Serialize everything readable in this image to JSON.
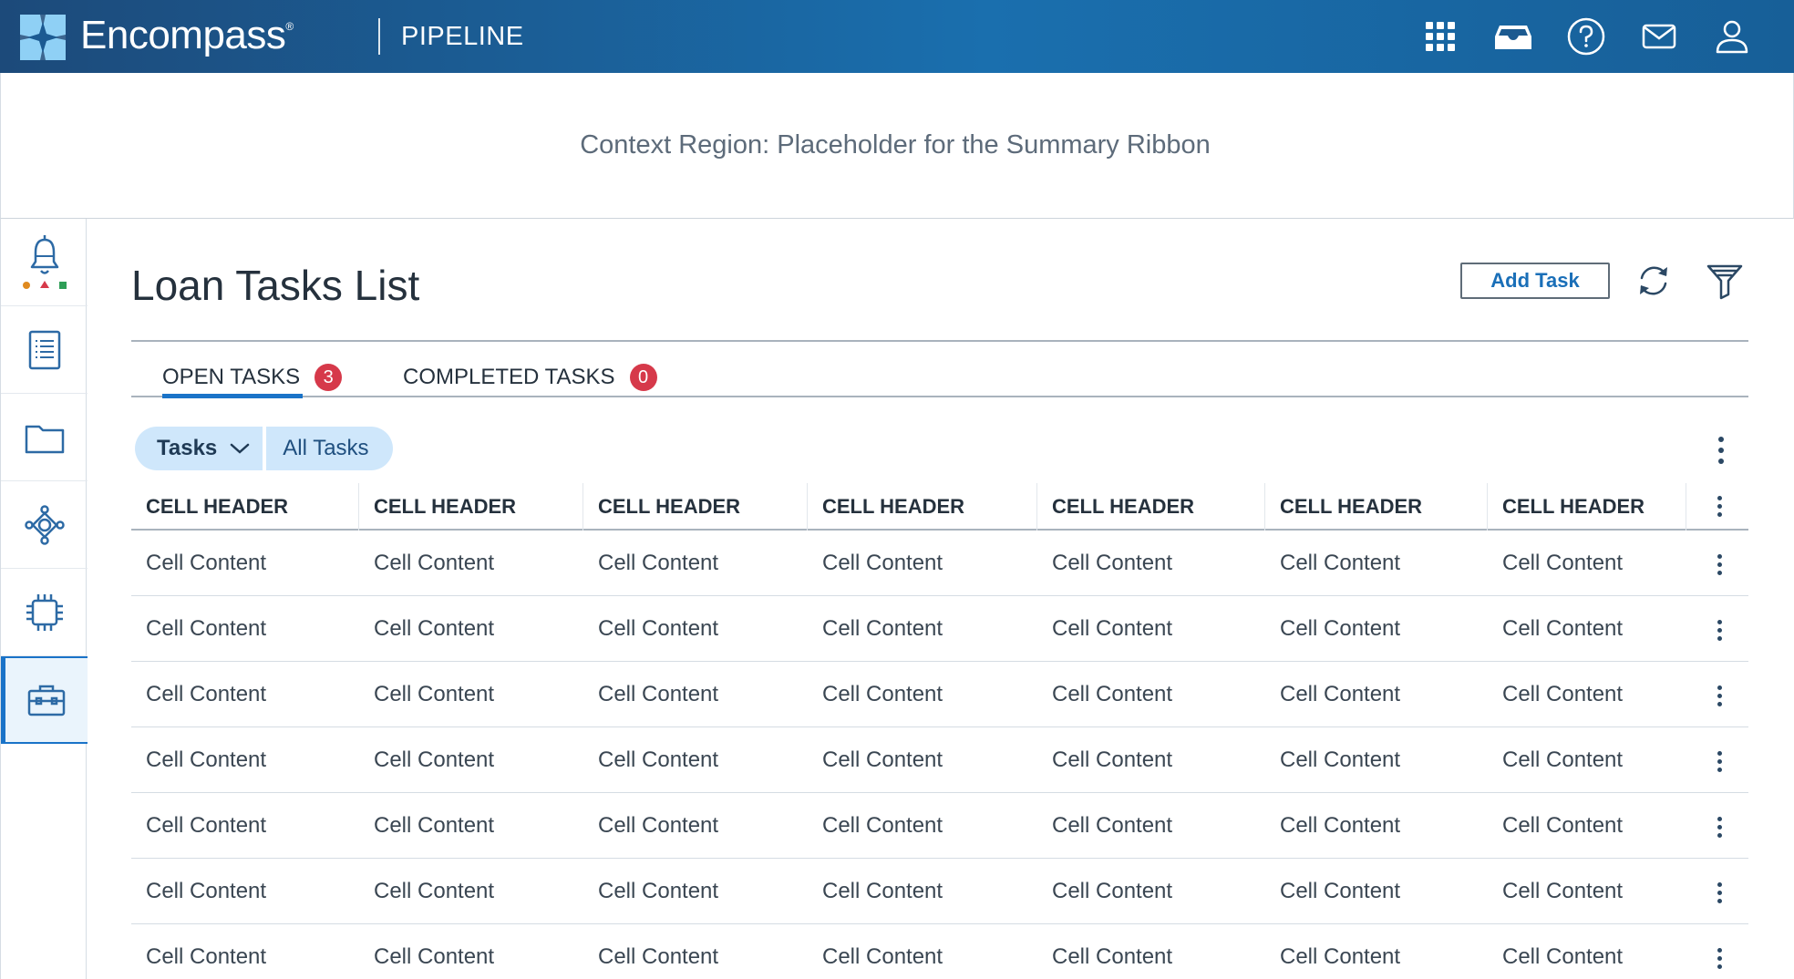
{
  "header": {
    "brand": "Encompass",
    "trademark": "®",
    "app_title": "PIPELINE",
    "icons": [
      "apps-grid-icon",
      "inbox-tray-icon",
      "help-icon",
      "mail-icon",
      "user-icon"
    ]
  },
  "context": {
    "text": "Context Region: Placeholder for the Summary Ribbon"
  },
  "rail": {
    "items": [
      "alerts-bell-icon",
      "forms-list-icon",
      "folder-icon",
      "services-network-icon",
      "chip-icon",
      "briefcase-icon"
    ],
    "active_index": 5,
    "alert_dot_colors": [
      "#e08a1f",
      "#d6394a",
      "#2e9e57"
    ]
  },
  "main": {
    "title": "Loan Tasks List",
    "add_task_label": "Add Task",
    "tabs": [
      {
        "label": "OPEN TASKS",
        "count": "3"
      },
      {
        "label": "COMPLETED TASKS",
        "count": "0"
      }
    ],
    "filter_chip": {
      "label": "Tasks",
      "value": "All Tasks"
    }
  },
  "table": {
    "headers": [
      "CELL HEADER",
      "CELL HEADER",
      "CELL HEADER",
      "CELL HEADER",
      "CELL HEADER",
      "CELL HEADER",
      "CELL HEADER"
    ],
    "rows": [
      [
        "Cell Content",
        "Cell Content",
        "Cell Content",
        "Cell Content",
        "Cell Content",
        "Cell Content",
        "Cell Content"
      ],
      [
        "Cell Content",
        "Cell Content",
        "Cell Content",
        "Cell Content",
        "Cell Content",
        "Cell Content",
        "Cell Content"
      ],
      [
        "Cell Content",
        "Cell Content",
        "Cell Content",
        "Cell Content",
        "Cell Content",
        "Cell Content",
        "Cell Content"
      ],
      [
        "Cell Content",
        "Cell Content",
        "Cell Content",
        "Cell Content",
        "Cell Content",
        "Cell Content",
        "Cell Content"
      ],
      [
        "Cell Content",
        "Cell Content",
        "Cell Content",
        "Cell Content",
        "Cell Content",
        "Cell Content",
        "Cell Content"
      ],
      [
        "Cell Content",
        "Cell Content",
        "Cell Content",
        "Cell Content",
        "Cell Content",
        "Cell Content",
        "Cell Content"
      ],
      [
        "Cell Content",
        "Cell Content",
        "Cell Content",
        "Cell Content",
        "Cell Content",
        "Cell Content",
        "Cell Content"
      ]
    ]
  },
  "colors": {
    "header_start": "#1c4a7a",
    "header_end": "#1a6fae",
    "accent": "#1a73c8",
    "badge": "#d6394a",
    "chip": "#cfe7fb"
  }
}
